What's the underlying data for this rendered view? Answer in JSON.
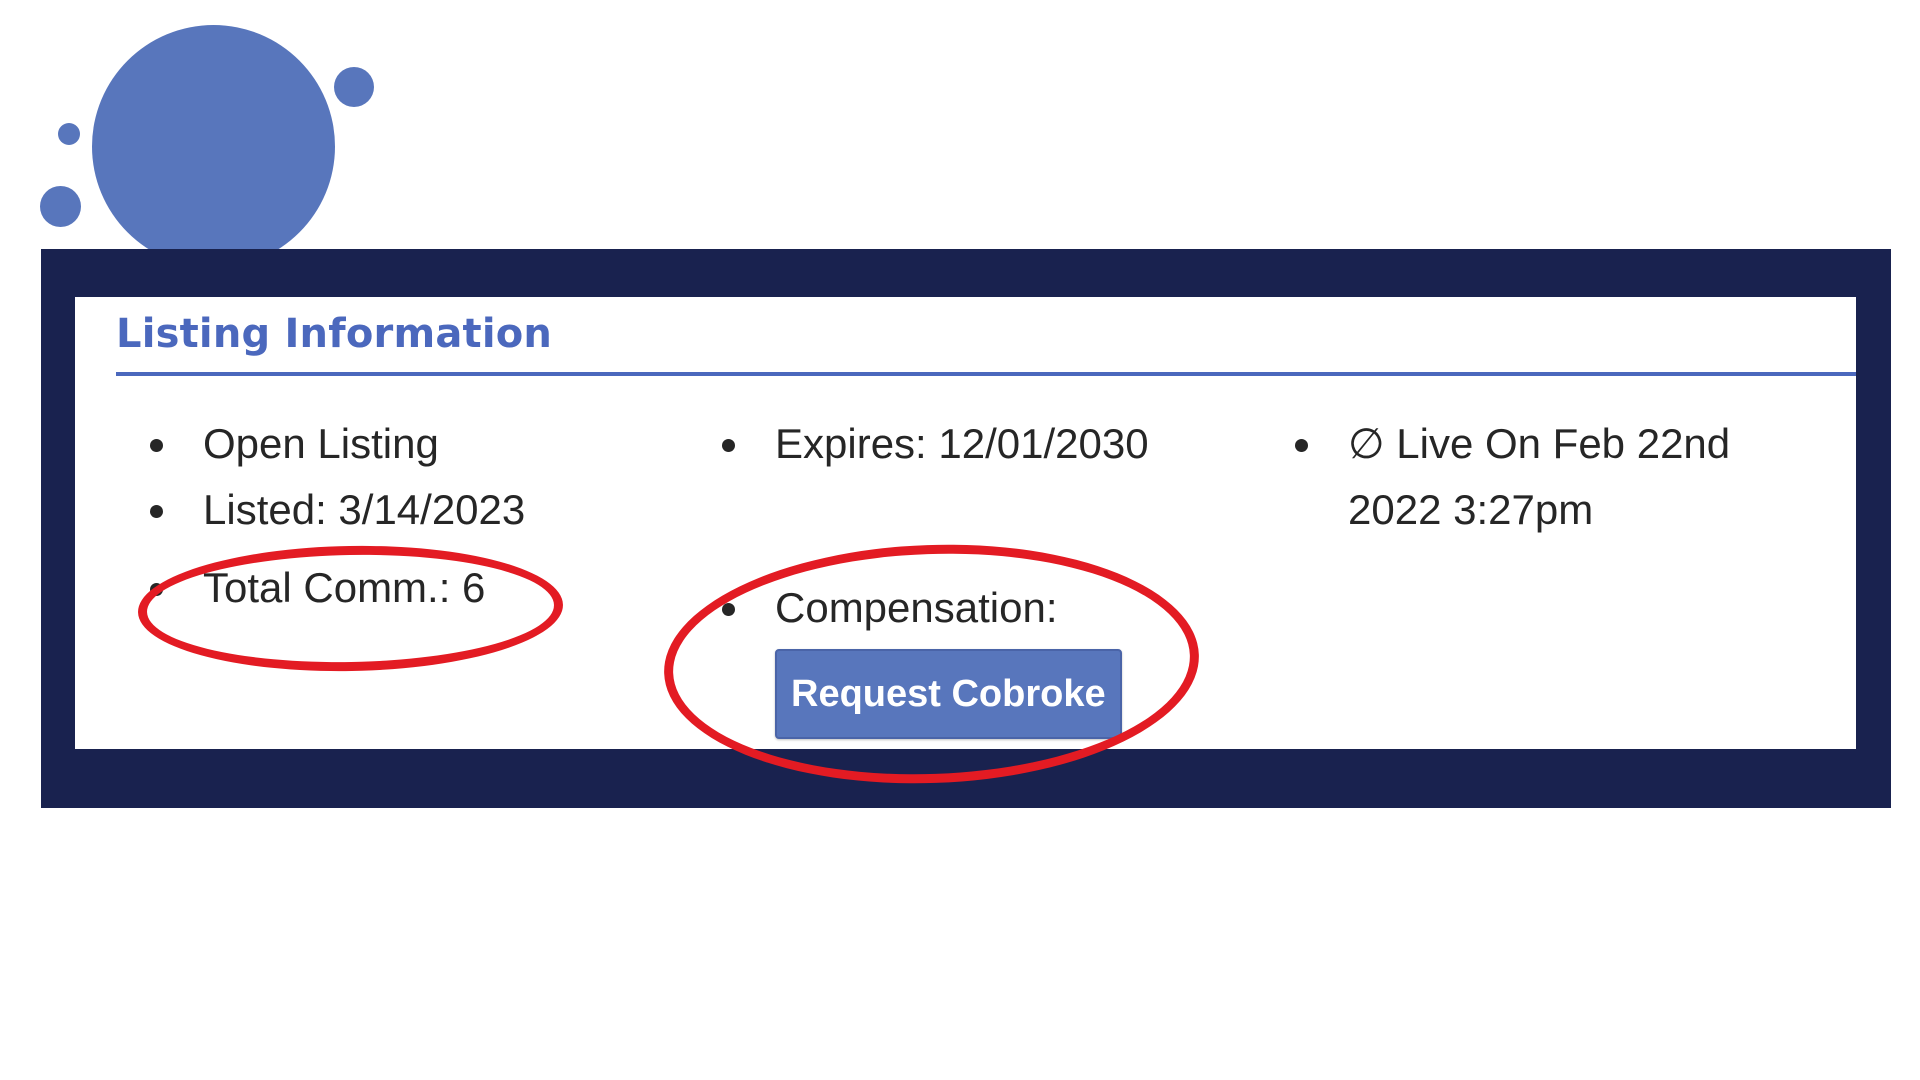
{
  "panel": {
    "title": "Listing Information"
  },
  "columns": {
    "left": {
      "status": "Open Listing",
      "listed": "Listed: 3/14/2023",
      "total_comm": "Total Comm.: 6"
    },
    "middle": {
      "expires": "Expires: 12/01/2030",
      "compensation_label": "Compensation:",
      "request_button": "Request Cobroke"
    },
    "right": {
      "live_on": "∅ Live On Feb 22nd 2022 3:27pm"
    }
  },
  "colors": {
    "accent": "#4b68bd",
    "button": "#5876bc",
    "frame": "#19224f",
    "annotation": "#e31b23",
    "decoration": "#5876bc"
  }
}
